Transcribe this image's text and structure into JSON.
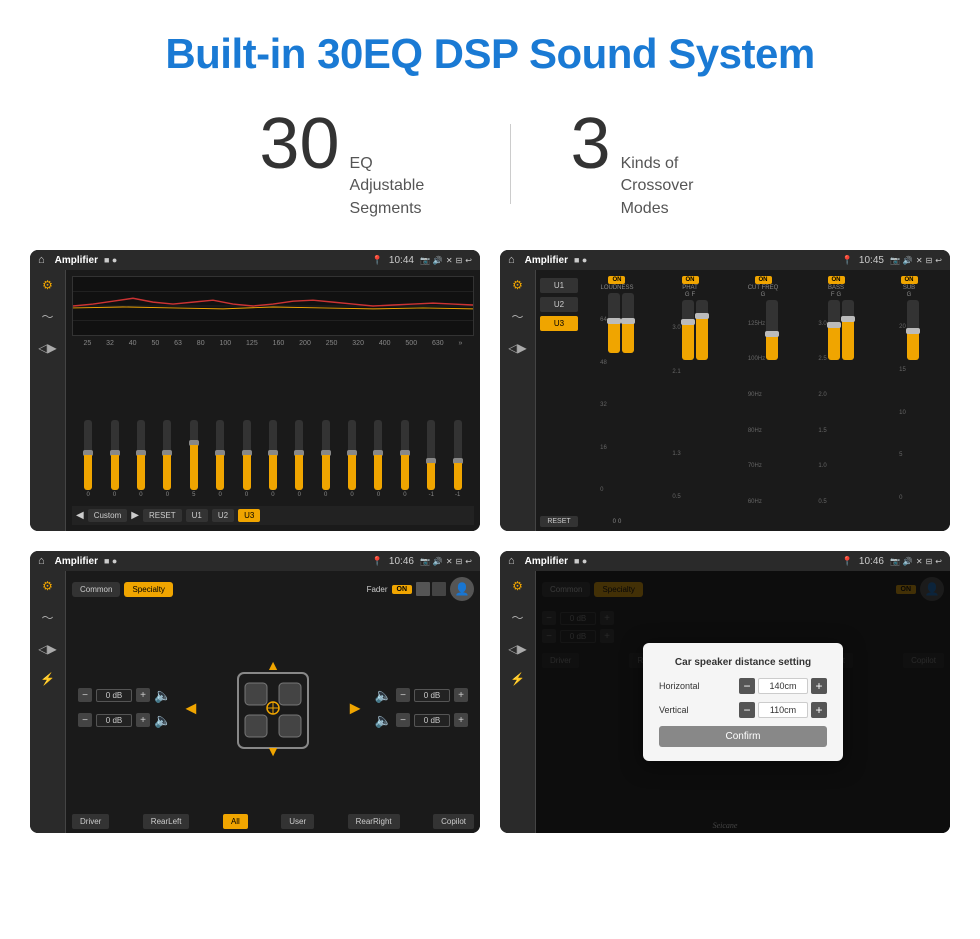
{
  "header": {
    "title": "Built-in 30EQ DSP Sound System",
    "stat1_number": "30",
    "stat1_label_line1": "EQ Adjustable",
    "stat1_label_line2": "Segments",
    "stat2_number": "3",
    "stat2_label_line1": "Kinds of",
    "stat2_label_line2": "Crossover Modes"
  },
  "screens": {
    "screen1": {
      "title": "Amplifier",
      "time": "10:44",
      "freq_labels": [
        "25",
        "32",
        "40",
        "50",
        "63",
        "80",
        "100",
        "125",
        "160",
        "200",
        "250",
        "320",
        "400",
        "500",
        "630"
      ],
      "slider_values": [
        "0",
        "0",
        "0",
        "0",
        "5",
        "0",
        "0",
        "0",
        "0",
        "0",
        "0",
        "0",
        "0",
        "-1",
        "0",
        "-1"
      ],
      "preset_buttons": [
        "Custom",
        "RESET",
        "U1",
        "U2",
        "U3"
      ]
    },
    "screen2": {
      "title": "Amplifier",
      "time": "10:45",
      "presets": [
        "U1",
        "U2",
        "U3"
      ],
      "active_preset": "U3",
      "channels": [
        "LOUDNESS",
        "PHAT",
        "CUT FREQ",
        "BASS",
        "SUB"
      ],
      "channel_values": [
        "64",
        "3.0",
        "125Hz",
        "100Hz",
        "20"
      ],
      "reset_label": "RESET"
    },
    "screen3": {
      "title": "Amplifier",
      "time": "10:46",
      "tab_common": "Common",
      "tab_specialty": "Specialty",
      "fader_label": "Fader",
      "on_label": "ON",
      "vol_labels": [
        "0 dB",
        "0 dB",
        "0 dB",
        "0 dB"
      ],
      "bottom_buttons": [
        "Driver",
        "RearLeft",
        "All",
        "User",
        "RearRight",
        "Copilot"
      ]
    },
    "screen4": {
      "title": "Amplifier",
      "time": "10:46",
      "tab_common": "Common",
      "tab_specialty": "Specialty",
      "dialog": {
        "title": "Car speaker distance setting",
        "horizontal_label": "Horizontal",
        "horizontal_value": "140cm",
        "vertical_label": "Vertical",
        "vertical_value": "110cm",
        "confirm_label": "Confirm"
      },
      "vol_labels": [
        "0 dB",
        "0 dB"
      ],
      "bottom_buttons": [
        "Driver",
        "RearLeft",
        "All",
        "User",
        "RearRight",
        "Copilot"
      ]
    }
  },
  "watermark": "Seicane"
}
